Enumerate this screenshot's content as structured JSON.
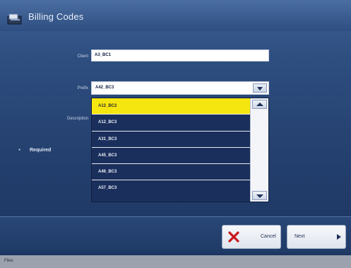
{
  "window": {
    "title": "Billing Codes",
    "icon": "billing-icon"
  },
  "form": {
    "client_label": "Client",
    "client_value": "A3_BC1",
    "prefix_label": "Prefix",
    "prefix_value": "A42_BC3",
    "description_label": "Description",
    "required_star": "*",
    "required_text": "Required"
  },
  "dropdown": {
    "items": [
      {
        "label": "A12_BC2",
        "selected": true
      },
      {
        "label": "A12_BC3",
        "selected": false
      },
      {
        "label": "A31_BC3",
        "selected": false
      },
      {
        "label": "A45_BC3",
        "selected": false
      },
      {
        "label": "A46_BC3",
        "selected": false
      },
      {
        "label": "A57_BC3",
        "selected": false
      }
    ]
  },
  "buttons": {
    "cancel_label": "Cancel",
    "next_label": "Next"
  },
  "status": {
    "text": "Files"
  },
  "colors": {
    "selected_item": "#f6e60f",
    "list_background": "#1b2f5c",
    "cancel_icon": "#c8161d"
  }
}
